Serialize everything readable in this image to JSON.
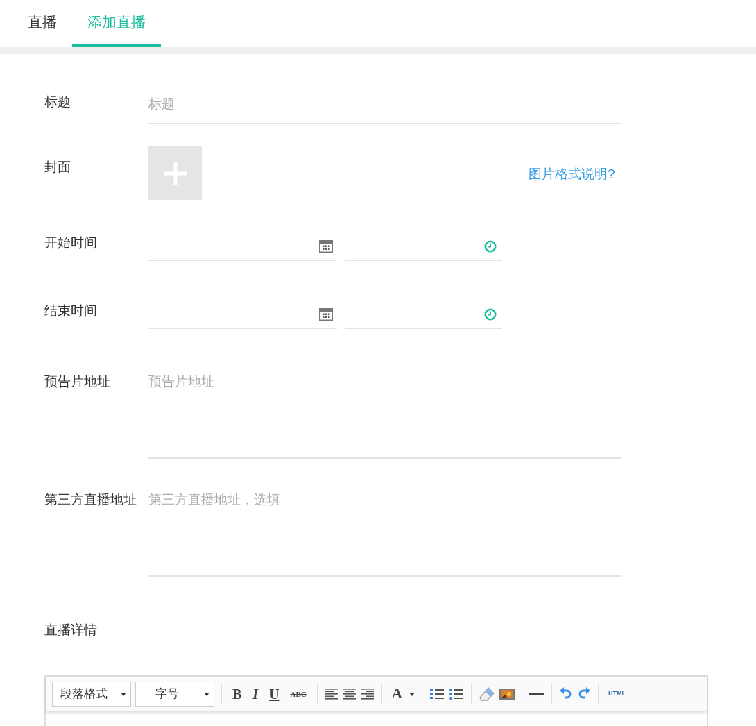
{
  "tabs": [
    {
      "label": "直播",
      "selected": false
    },
    {
      "label": "添加直播",
      "selected": true
    }
  ],
  "form": {
    "title": {
      "label": "标题",
      "placeholder": "标题"
    },
    "cover": {
      "label": "封面",
      "link": "图片格式说明?"
    },
    "start_time": {
      "label": "开始时间"
    },
    "end_time": {
      "label": "结束时间"
    },
    "trailer_url": {
      "label": "预告片地址",
      "placeholder": "预告片地址"
    },
    "third_party_url": {
      "label": "第三方直播地址",
      "placeholder": "第三方直播地址，选填"
    },
    "details": {
      "label": "直播详情"
    }
  },
  "editor_toolbar": {
    "selects": [
      "段落格式",
      "字号"
    ],
    "format_buttons": [
      "B",
      "I",
      "U",
      "ABC"
    ],
    "color_button": "A",
    "html_button": "HTML"
  }
}
